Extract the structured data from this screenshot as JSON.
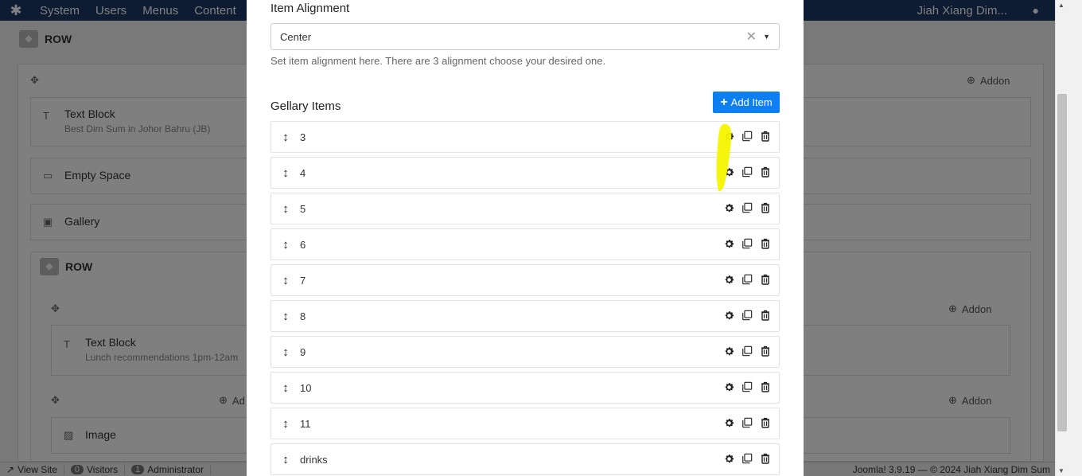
{
  "topbar": {
    "menu": [
      "System",
      "Users",
      "Menus",
      "Content"
    ],
    "user": "Jiah Xiang Dim..."
  },
  "background": {
    "row1_label": "ROW",
    "addon_label": "Addon",
    "text_block_label": "Text Block",
    "text_block_sub": "Best Dim Sum in Johor Bahru (JB)",
    "empty_space_label": "Empty Space",
    "gallery_label": "Gallery",
    "row2_label": "ROW",
    "text_block2_label": "Text Block",
    "text_block2_sub": "Lunch recommendations 1pm-12am",
    "add_partial": "Ad",
    "image_label": "Image"
  },
  "statusbar": {
    "view_site": "View Site",
    "visitors_count": "0",
    "visitors": "Visitors",
    "admin_count": "1",
    "admin": "Administrator",
    "footer": "Joomla! 3.9.19 — © 2024 Jiah Xiang Dim Sum"
  },
  "modal": {
    "alignment_label": "Item Alignment",
    "alignment_value": "Center",
    "alignment_help": "Set item alignment here. There are 3 alignment choose your desired one.",
    "items_title": "Gellary Items",
    "add_item_label": "Add Item",
    "items": [
      "3",
      "4",
      "5",
      "6",
      "7",
      "8",
      "9",
      "10",
      "11",
      "drinks"
    ]
  },
  "colors": {
    "accent": "#0d7ff0",
    "highlight": "#f5f500",
    "topbar": "#1a3867"
  },
  "icons": {
    "handle": "drag-vertical-icon",
    "settings": "gear-icon",
    "duplicate": "copy-icon",
    "delete": "trash-icon"
  }
}
